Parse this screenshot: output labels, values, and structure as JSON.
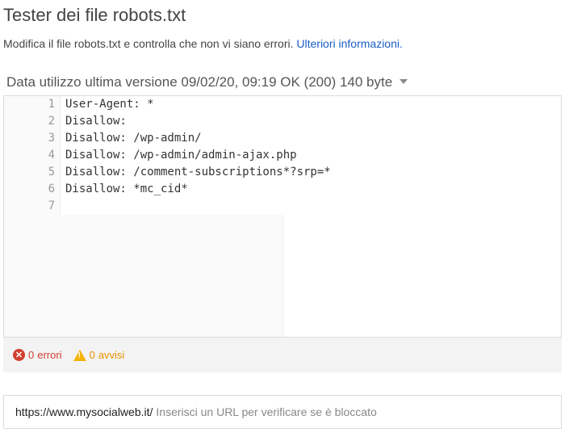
{
  "header": {
    "title": "Tester dei file robots.txt",
    "intro_text": "Modifica il file robots.txt e controlla che non vi siano errori. ",
    "intro_link": "Ulteriori informazioni."
  },
  "status": {
    "text": "Data utilizzo ultima versione 09/02/20, 09:19 OK (200) 140 byte"
  },
  "robots_lines": [
    "User-Agent: *",
    "Disallow:",
    "Disallow: /wp-admin/",
    "Disallow: /wp-admin/admin-ajax.php",
    "Disallow: /comment-subscriptions*?srp=*",
    "Disallow: *mc_cid*",
    ""
  ],
  "messages": {
    "errors_count": "0",
    "errors_label": "errori",
    "warnings_count": "0",
    "warnings_label": "avvisi"
  },
  "url_test": {
    "prefix": "https://www.mysocialweb.it/",
    "placeholder": "Inserisci un URL per verificare se è bloccato"
  }
}
